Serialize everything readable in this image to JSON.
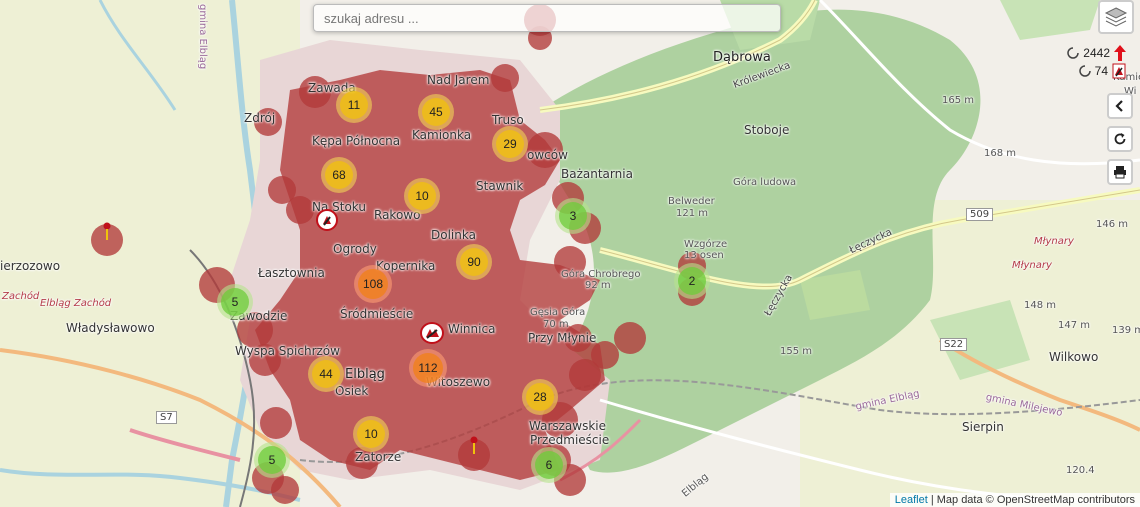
{
  "search": {
    "placeholder": "szukaj adresu ..."
  },
  "controls": {
    "layers_icon": "layers-icon",
    "collapse_icon": "chevron-left-icon",
    "refresh_icon": "refresh-icon",
    "print_icon": "printer-icon"
  },
  "counters": [
    {
      "value": "2442",
      "icon": "red-arrow-up-icon"
    },
    {
      "value": "74",
      "icon": "fire-brigade-icon"
    }
  ],
  "attribution": {
    "leaflet": "Leaflet",
    "text": " | Map data © OpenStreetMap contributors"
  },
  "colors": {
    "coverage": "#b23a3a",
    "forest": "#aed1a0",
    "yellow_cluster": "#f0c20c",
    "orange_cluster": "#f18017",
    "green_cluster": "#6ecc39",
    "marker_red": "#c0101a"
  },
  "places": {
    "zawada": "Zawada",
    "nad_jarem": "Nad Jarem",
    "dabrowa": "Dąbrowa",
    "zdroj": "Zdrój",
    "kepa": "Kępa Północna",
    "kamionka": "Kamionka",
    "truso": "Truso",
    "nowcow": "owców",
    "bazantarnia": "Bażantarnia",
    "stoboje": "Stoboje",
    "na_stoku": "Na Stoku",
    "rakowo": "Rakowo",
    "stawnik": "Stawnik",
    "gora_ludowa": "Góra ludowa",
    "belweder": "Belweder",
    "belweder_h": "121 m",
    "dolinka": "Dolinka",
    "ogrody": "Ogrody",
    "kopernika": "Kopernika",
    "lasztownia": "Łasztownia",
    "wzgorze": "Wzgórze",
    "wzgorze2": "13 osen",
    "gora_chrobrego": "Góra Chrobrego",
    "gora_chrobrego_h": "92 m",
    "irzozowo": "ierzozowo",
    "zachod": "Zachód",
    "elblag_zachod": "Elbląg Zachód",
    "zawodzie": "Zawodzie",
    "wladyslawowo": "Władysławowo",
    "srodmiescie": "Śródmieście",
    "winnica": "Winnica",
    "gesia_gora": "Gęsia Góra",
    "gesia_gora_h": "70 m",
    "przy_mlynie": "Przy Młynie",
    "wyspa": "Wyspa Spichrzów",
    "elblag": "Elbląg",
    "osiek": "Osiek",
    "witoszewo": "Witoszewo",
    "warszawskie": "Warszawskie",
    "przedmiescie": "Przedmieście",
    "zatorze": "Zatorze",
    "sierpin": "Sierpin",
    "wilkowo": "Wilkowo",
    "mlynary": "Młynary",
    "mlynary_rail": "Młynary",
    "gmina_elblag": "gmina Elbląg",
    "gmina_elblag_2": "gmina Elbląg",
    "gmina_milejewo": "gmina Milejewo",
    "elblag_rail": "Elbląg",
    "krolewiecka": "Królewiecka",
    "leczycka": "Łęczycka",
    "leczycka2": "Łęczycka",
    "road_509": "509",
    "road_s22": "S22",
    "road_s7": "S7",
    "kamie": "Kamie",
    "wi": "Wi",
    "h165": "165 m",
    "h168": "168 m",
    "h146": "146 m",
    "h148": "148 m",
    "h147": "147 m",
    "h139": "139 m",
    "h155": "155 m",
    "h120": "120.4"
  },
  "clusters": [
    {
      "count": "11",
      "color": "yellow"
    },
    {
      "count": "45",
      "color": "yellow"
    },
    {
      "count": "29",
      "color": "yellow"
    },
    {
      "count": "68",
      "color": "yellow"
    },
    {
      "count": "10",
      "color": "yellow"
    },
    {
      "count": "90",
      "color": "yellow"
    },
    {
      "count": "108",
      "color": "orange"
    },
    {
      "count": "44",
      "color": "yellow"
    },
    {
      "count": "112",
      "color": "orange"
    },
    {
      "count": "28",
      "color": "yellow"
    },
    {
      "count": "10",
      "color": "yellow"
    },
    {
      "count": "3",
      "color": "green"
    },
    {
      "count": "2",
      "color": "green"
    },
    {
      "count": "5",
      "color": "green"
    },
    {
      "count": "5",
      "color": "green"
    },
    {
      "count": "6",
      "color": "green"
    }
  ],
  "markers": [
    {
      "icon": "fire-station-icon"
    },
    {
      "icon": "fire-station-icon"
    },
    {
      "icon": "fire-station-icon"
    }
  ]
}
